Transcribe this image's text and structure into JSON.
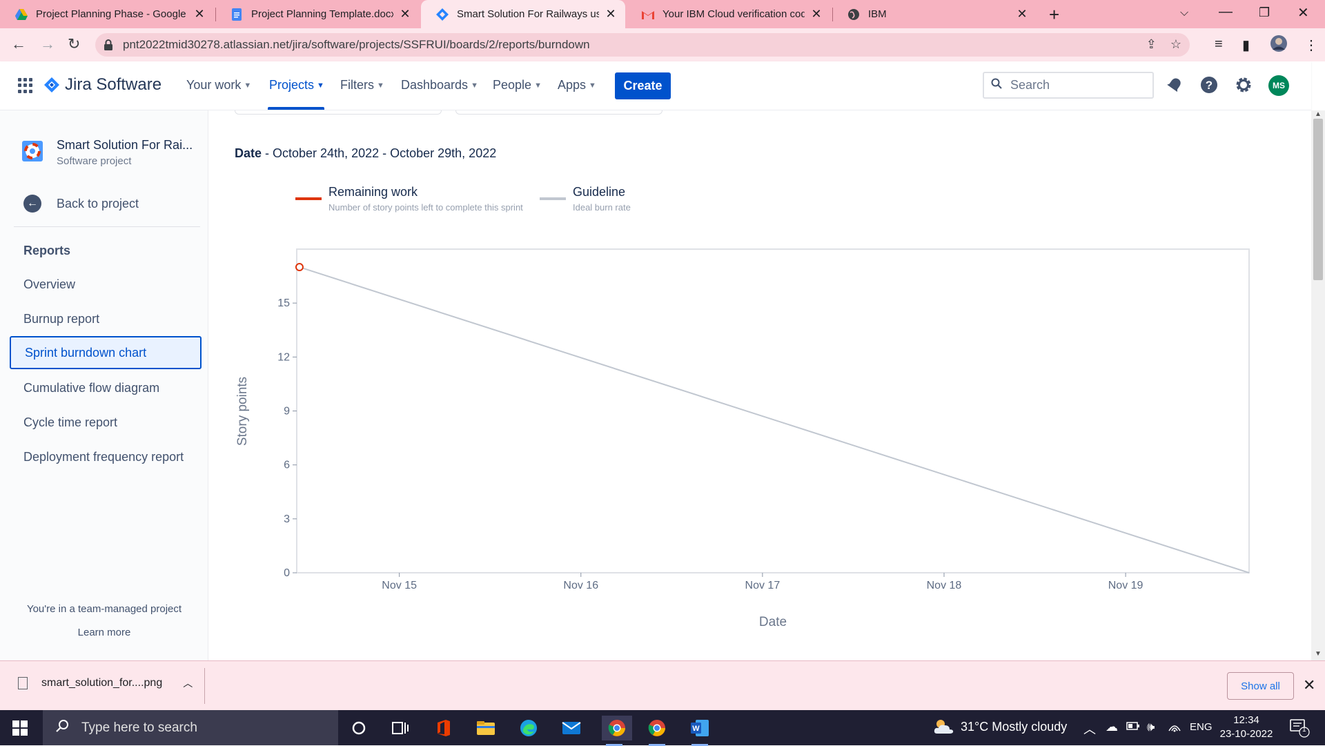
{
  "browser": {
    "tabs": [
      {
        "title": "Project Planning Phase - Google",
        "icon": "google-drive-icon",
        "color": "#f4b400"
      },
      {
        "title": "Project Planning Template.docx -",
        "icon": "google-docs-icon",
        "color": "#4285f4"
      },
      {
        "title": "Smart Solution For Railways usin",
        "icon": "jira-icon",
        "color": "#2684ff"
      },
      {
        "title": "Your IBM Cloud verification code",
        "icon": "gmail-icon",
        "color": "#ea4335"
      },
      {
        "title": "IBM",
        "icon": "globe-icon",
        "color": "#202124"
      }
    ],
    "url": "pnt2022tmid30278.atlassian.net/jira/software/projects/SSFRUI/boards/2/reports/burndown"
  },
  "jira": {
    "product": "Jira Software",
    "nav": {
      "your_work": "Your work",
      "projects": "Projects",
      "filters": "Filters",
      "dashboards": "Dashboards",
      "people": "People",
      "apps": "Apps"
    },
    "create_label": "Create",
    "search_placeholder": "Search",
    "avatar_initials": "MS",
    "brand_color": "#0052cc"
  },
  "sidebar": {
    "project_name": "Smart Solution For Rai...",
    "project_type": "Software project",
    "back_label": "Back to project",
    "reports_heading": "Reports",
    "items": [
      {
        "label": "Overview",
        "active": false
      },
      {
        "label": "Burnup report",
        "active": false
      },
      {
        "label": "Sprint burndown chart",
        "active": true
      },
      {
        "label": "Cumulative flow diagram",
        "active": false
      },
      {
        "label": "Cycle time report",
        "active": false
      },
      {
        "label": "Deployment frequency report",
        "active": false
      }
    ],
    "footer_text": "You're in a team-managed project",
    "learn_more": "Learn more"
  },
  "report": {
    "date_label": "Date",
    "date_range": " - October 24th, 2022 - October 29th, 2022",
    "legend": [
      {
        "title": "Remaining work",
        "desc": "Number of story points left to complete this sprint",
        "color": "#de350b"
      },
      {
        "title": "Guideline",
        "desc": "Ideal burn rate",
        "color": "#c1c7d0"
      }
    ]
  },
  "chart_data": {
    "type": "line",
    "xlabel": "Date",
    "ylabel": "Story points",
    "y_ticks": [
      0,
      3,
      6,
      9,
      12,
      15
    ],
    "ylim": [
      0,
      18
    ],
    "x_ticks": [
      "Nov 15",
      "Nov 16",
      "Nov 17",
      "Nov 18",
      "Nov 19"
    ],
    "xlim_days": [
      14.435,
      19.68
    ],
    "series": [
      {
        "name": "Guideline",
        "color": "#c1c7d0",
        "points": [
          {
            "x": "Nov 14",
            "y": 17
          },
          {
            "x": "Nov 19",
            "y": 0
          }
        ],
        "x_days": [
          14.45,
          19.68
        ]
      },
      {
        "name": "Remaining work",
        "color": "#de350b",
        "points": [
          {
            "x": "Nov 14",
            "y": 17
          }
        ],
        "x_days": [
          14.45
        ]
      }
    ],
    "grid": false
  },
  "downloads": {
    "file_name": "smart_solution_for....png",
    "show_all": "Show all"
  },
  "taskbar": {
    "search_placeholder": "Type here to search",
    "weather": "31°C  Mostly cloudy",
    "language": "ENG",
    "time": "12:34",
    "date": "23-10-2022",
    "notification_count": "1"
  }
}
